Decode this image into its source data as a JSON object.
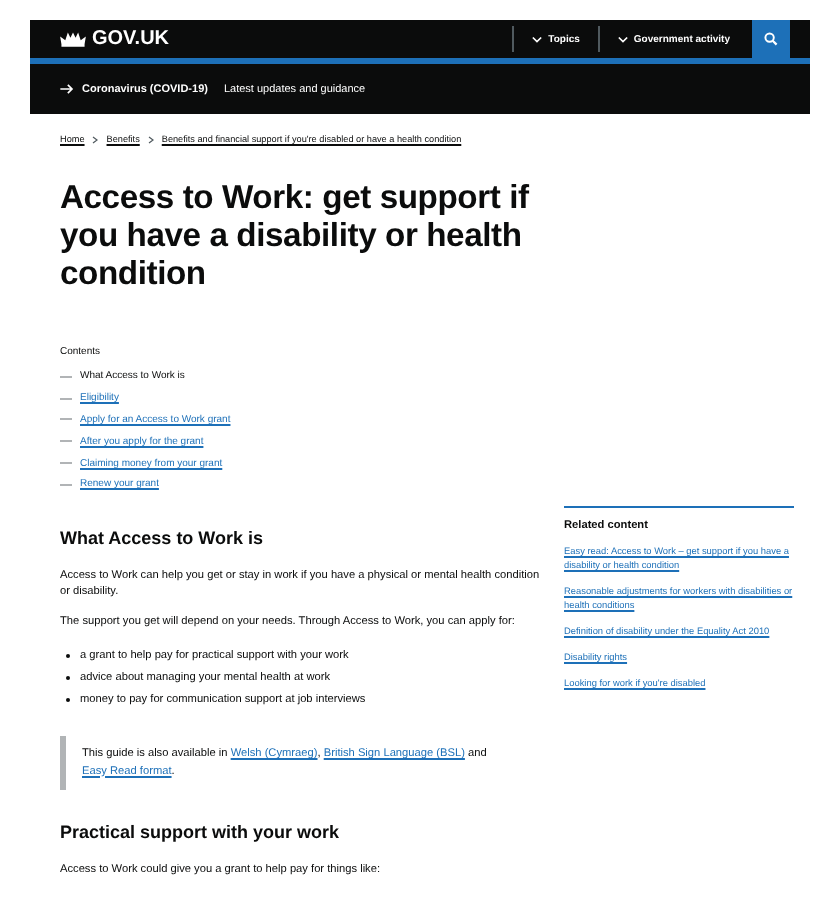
{
  "header": {
    "logo": "GOV.UK",
    "nav": [
      {
        "label": "Topics"
      },
      {
        "label": "Government activity"
      }
    ]
  },
  "banner": {
    "link": "Coronavirus (COVID-19)",
    "text": "Latest updates and guidance"
  },
  "breadcrumbs": [
    "Home",
    "Benefits",
    "Benefits and financial support if you're disabled or have a health condition"
  ],
  "title": "Access to Work: get support if you have a disability or health condition",
  "contents": {
    "label": "Contents",
    "items": [
      {
        "label": "What Access to Work is",
        "selected": true
      },
      {
        "label": "Eligibility",
        "selected": false
      },
      {
        "label": "Apply for an Access to Work grant",
        "selected": false
      },
      {
        "label": "After you apply for the grant",
        "selected": false
      },
      {
        "label": "Claiming money from your grant",
        "selected": false
      },
      {
        "label": "Renew your grant",
        "selected": false
      }
    ]
  },
  "sections": [
    {
      "heading": "What Access to Work is",
      "paragraphs": [
        "Access to Work can help you get or stay in work if you have a physical or mental health condition or disability.",
        "The support you get will depend on your needs. Through Access to Work, you can apply for:"
      ],
      "bullets": [
        "a grant to help pay for practical support with your work",
        "advice about managing your mental health at work",
        "money to pay for communication support at job interviews"
      ],
      "inset": {
        "before": "This guide is also available in ",
        "links": [
          "Welsh (Cymraeg)",
          "British Sign Language (BSL)",
          "Easy Read format"
        ],
        "separators": [
          ", ",
          " and ",
          "."
        ]
      }
    },
    {
      "heading": "Practical support with your work",
      "paragraphs": [
        "Access to Work could give you a grant to help pay for things like:"
      ]
    }
  ],
  "related": {
    "heading": "Related content",
    "links": [
      "Easy read: Access to Work – get support if you have a disability or health condition",
      "Reasonable adjustments for workers with disabilities or health conditions",
      "Definition of disability under the Equality Act 2010",
      "Disability rights",
      "Looking for work if you're disabled"
    ]
  }
}
